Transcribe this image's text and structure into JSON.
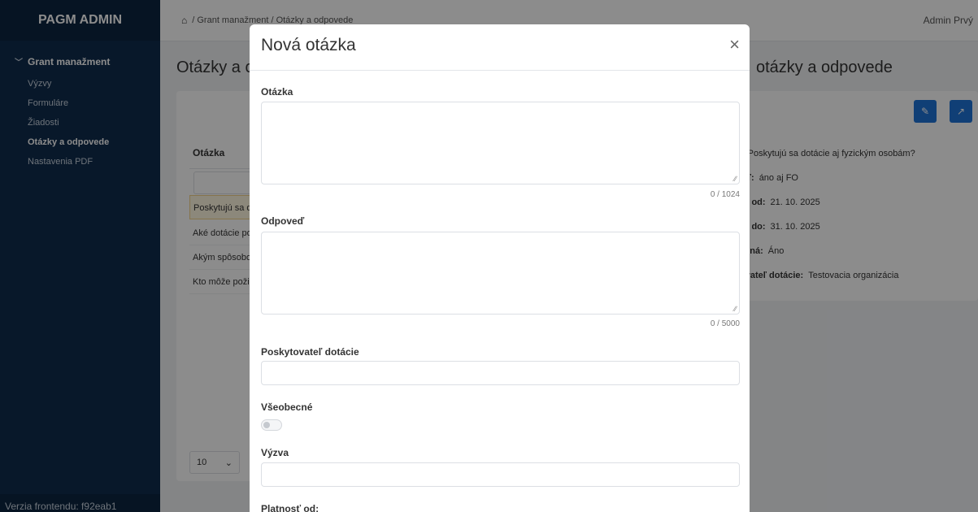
{
  "sidebar": {
    "brand": "PAGM ADMIN",
    "group_label": "Grant manažment",
    "items": [
      {
        "label": "Výzvy"
      },
      {
        "label": "Formuláre"
      },
      {
        "label": "Žiadosti"
      },
      {
        "label": "Otázky a odpovede"
      },
      {
        "label": "Nastavenia PDF"
      }
    ],
    "footer": "Verzia frontendu: f92eab1"
  },
  "topbar": {
    "breadcrumb": "/ Grant manažment / Otázky a odpovede",
    "user": "Admin Prvý"
  },
  "page": {
    "title_left": "Otázky a c",
    "title_right": "otázky a odpovede",
    "table_header": "Otázka",
    "rows": [
      {
        "text": "Poskytujú sa d"
      },
      {
        "text": "Aké dotácie po"
      },
      {
        "text": "Akým spôsobo"
      },
      {
        "text": "Kto môže poži"
      }
    ],
    "page_size": "10",
    "details": [
      {
        "label": ":",
        "value": "Poskytujú sa dotácie aj fyzickým osobám?"
      },
      {
        "label": "eď:",
        "value": "áno aj FO"
      },
      {
        "label": "sť od:",
        "value": "21. 10. 2025"
      },
      {
        "label": "sť do:",
        "value": "31. 10. 2025"
      },
      {
        "label": "ecná:",
        "value": "Áno"
      },
      {
        "label": "ovateľ dotácie:",
        "value": "Testovacia organizácia"
      }
    ]
  },
  "modal": {
    "title": "Nová otázka",
    "close_glyph": "×",
    "fields": {
      "question_label": "Otázka",
      "question_counter": "0 / 1024",
      "answer_label": "Odpoveď",
      "answer_counter": "0 / 5000",
      "provider_label": "Poskytovateľ dotácie",
      "general_label": "Všeobecné",
      "call_label": "Výzva",
      "valid_from_label": "Platnosť od:"
    }
  },
  "colors": {
    "sidebar": "#0f2c4d",
    "accent": "#1e73d8",
    "overlay": "rgba(0,0,0,0.45)"
  }
}
